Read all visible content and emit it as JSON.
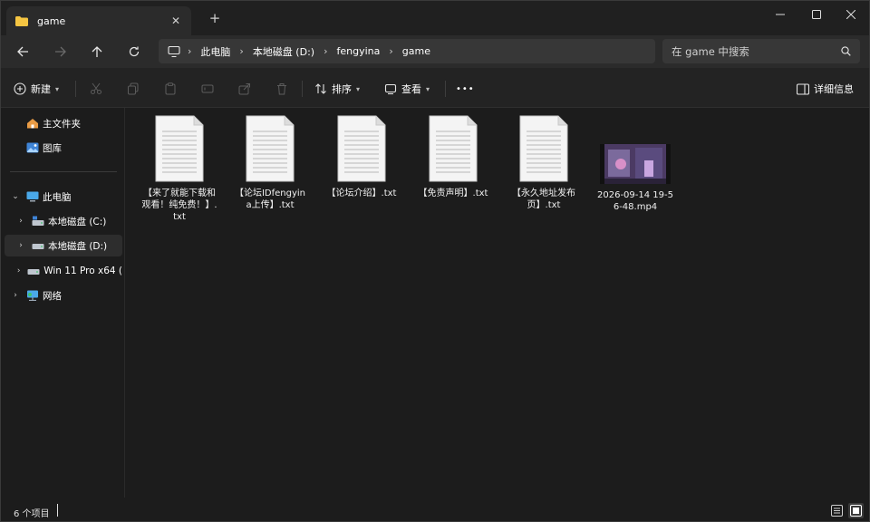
{
  "tab": {
    "title": "game",
    "close_icon": "close-icon",
    "new_tab_label": "+"
  },
  "window_controls": [
    "minimize-icon",
    "maximize-icon",
    "close-icon"
  ],
  "address": {
    "breadcrumbs": [
      "此电脑",
      "本地磁盘 (D:)",
      "fengyina",
      "game"
    ],
    "search_placeholder": "在 game 中搜索"
  },
  "commandbar": {
    "new_label": "新建",
    "sort_label": "排序",
    "view_label": "查看",
    "more_label": "•••",
    "details_label": "详细信息"
  },
  "sidebar": {
    "home": "主文件夹",
    "gallery": "图库",
    "this_pc": "此电脑",
    "drive_c": "本地磁盘 (C:)",
    "drive_d": "本地磁盘 (D:)",
    "drive_win": "Win 11 Pro x64 (",
    "network": "网络"
  },
  "files": [
    {
      "name": "【来了就能下载和观看！纯免费！】.txt",
      "type": "txt"
    },
    {
      "name": "【论坛IDfengyina上传】.txt",
      "type": "txt"
    },
    {
      "name": "【论坛介绍】.txt",
      "type": "txt"
    },
    {
      "name": "【免责声明】.txt",
      "type": "txt"
    },
    {
      "name": "【永久地址发布页】.txt",
      "type": "txt"
    },
    {
      "name": "2026-09-14 19-56-48.mp4",
      "type": "mp4"
    }
  ],
  "status": {
    "item_count": "6 个项目"
  },
  "colors": {
    "background": "#1c1c1c",
    "toolbar": "#2b2b2b",
    "folder": "#f5c542",
    "accent": "#4a9eda"
  }
}
